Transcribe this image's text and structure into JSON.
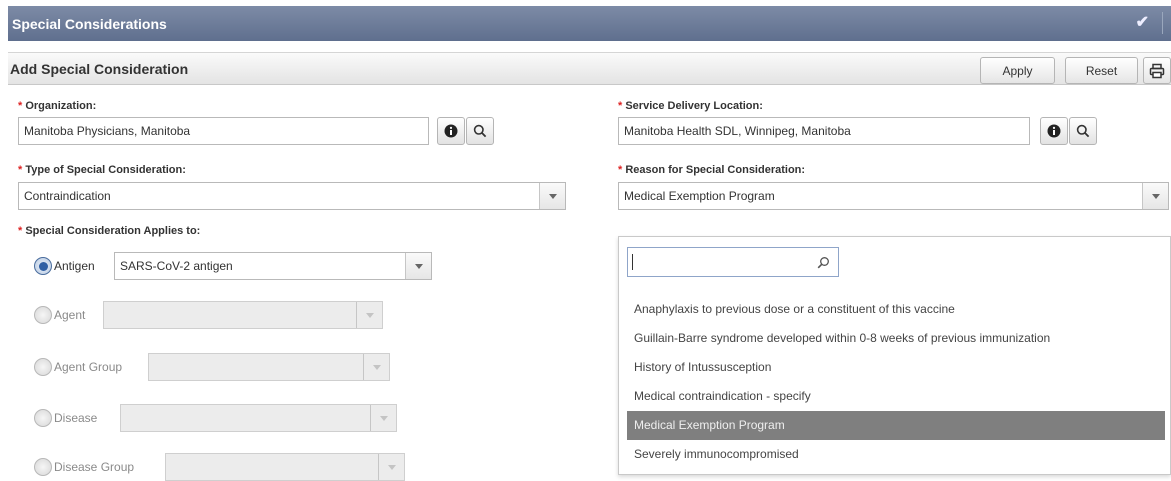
{
  "window": {
    "title": "Special Considerations"
  },
  "panel": {
    "title": "Add Special Consideration",
    "apply_label": "Apply",
    "reset_label": "Reset"
  },
  "form": {
    "required_marker": "*",
    "organization": {
      "label": "Organization:",
      "value": "Manitoba Physicians, Manitoba"
    },
    "sdl": {
      "label": "Service Delivery Location:",
      "value": "Manitoba Health SDL, Winnipeg, Manitoba"
    },
    "type": {
      "label": "Type of Special Consideration:",
      "value": "Contraindication"
    },
    "reason": {
      "label": "Reason for Special Consideration:",
      "value": "Medical Exemption Program"
    },
    "applies_to": {
      "label": "Special Consideration Applies to:",
      "options": [
        {
          "label": "Antigen",
          "value": "SARS-CoV-2 antigen",
          "selected": true
        },
        {
          "label": "Agent",
          "value": "",
          "selected": false
        },
        {
          "label": "Agent Group",
          "value": "",
          "selected": false
        },
        {
          "label": "Disease",
          "value": "",
          "selected": false
        },
        {
          "label": "Disease Group",
          "value": "",
          "selected": false
        }
      ]
    }
  },
  "reason_dropdown": {
    "search_value": "",
    "options": [
      "Anaphylaxis to previous dose or a constituent of this vaccine",
      "Guillain-Barre syndrome developed within 0-8 weeks of previous immunization",
      "History of Intussusception",
      "Medical contraindication - specify",
      "Medical Exemption Program",
      "Severely immunocompromised"
    ],
    "selected_index": 4
  },
  "icons": {
    "info": "info-icon",
    "search": "magnifier-icon",
    "print": "printer-icon",
    "check": "checkmark-icon"
  },
  "colors": {
    "titlebar": "#6b7a97",
    "selected_option": "#7f7f7f",
    "radio_selected": "#2f5fa4",
    "required": "#d22222"
  }
}
